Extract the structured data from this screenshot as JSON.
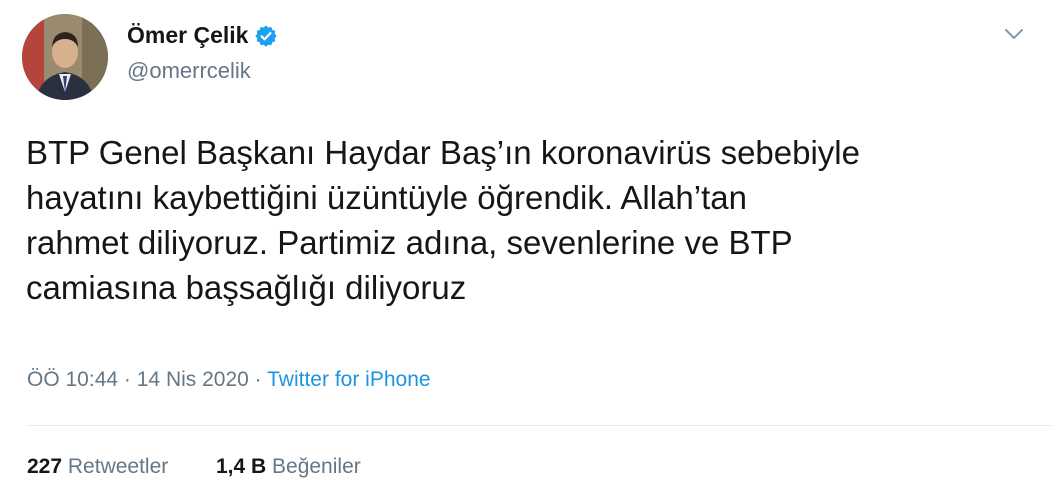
{
  "author": {
    "display_name": "Ömer Çelik",
    "handle": "@omerrcelik",
    "verified": true,
    "verified_color": "#1da1f2"
  },
  "tweet": {
    "text": "BTP Genel Başkanı Haydar Baş’ın  koronavirüs sebebiyle\nhayatını kaybettiğini üzüntüyle öğrendik. Allah’tan\nrahmet diliyoruz. Partimiz adına, sevenlerine ve BTP\ncamiasına başsağlığı diliyoruz",
    "time": "ÖÖ 10:44",
    "separator1": "·",
    "date": "14 Nis 2020",
    "separator2": "·",
    "source": "Twitter for iPhone"
  },
  "stats": {
    "retweets_count": "227",
    "retweets_label": "Retweetler",
    "likes_count": "1,4 B",
    "likes_label": "Beğeniler"
  },
  "icons": {
    "avatar": "profile-photo",
    "verified": "verified-badge-icon",
    "menu": "chevron-down-icon"
  },
  "colors": {
    "text": "#14171a",
    "secondary": "#657786",
    "link": "#1b95e0",
    "divider": "#e6ecf0"
  }
}
